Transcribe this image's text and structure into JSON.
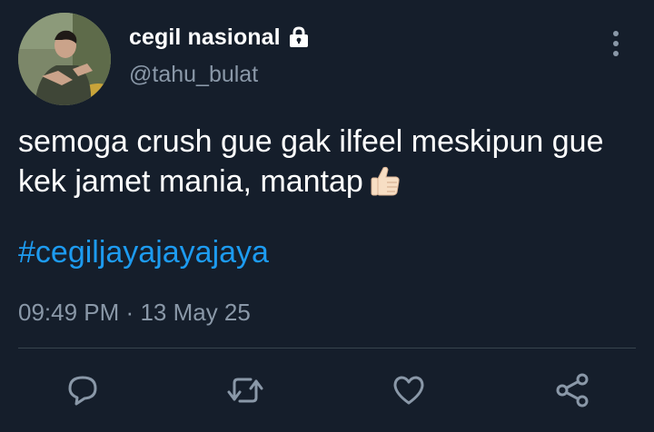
{
  "user": {
    "display_name": "cegil nasional",
    "username": "@tahu_bulat",
    "protected_icon": "lock-icon",
    "avatar": "profile-photo"
  },
  "tweet": {
    "text": "semoga crush gue gak ilfeel meskipun gue kek jamet mania, mantap",
    "emoji": "thumbs-up-emoji",
    "hashtag": "#cegiljayajayajaya",
    "time": "09:49 PM",
    "separator": "·",
    "date": "13 May 25",
    "timestamp": "09:49 PM · 13 May 25"
  },
  "actions": [
    {
      "name": "reply",
      "icon": "reply-icon"
    },
    {
      "name": "retweet",
      "icon": "retweet-icon"
    },
    {
      "name": "like",
      "icon": "heart-icon"
    },
    {
      "name": "share",
      "icon": "share-icon"
    }
  ],
  "colors": {
    "background": "#151e2b",
    "text_primary": "#ffffff",
    "text_secondary": "#8a98a8",
    "hashtag": "#1d9bf0",
    "divider": "#38444d"
  }
}
